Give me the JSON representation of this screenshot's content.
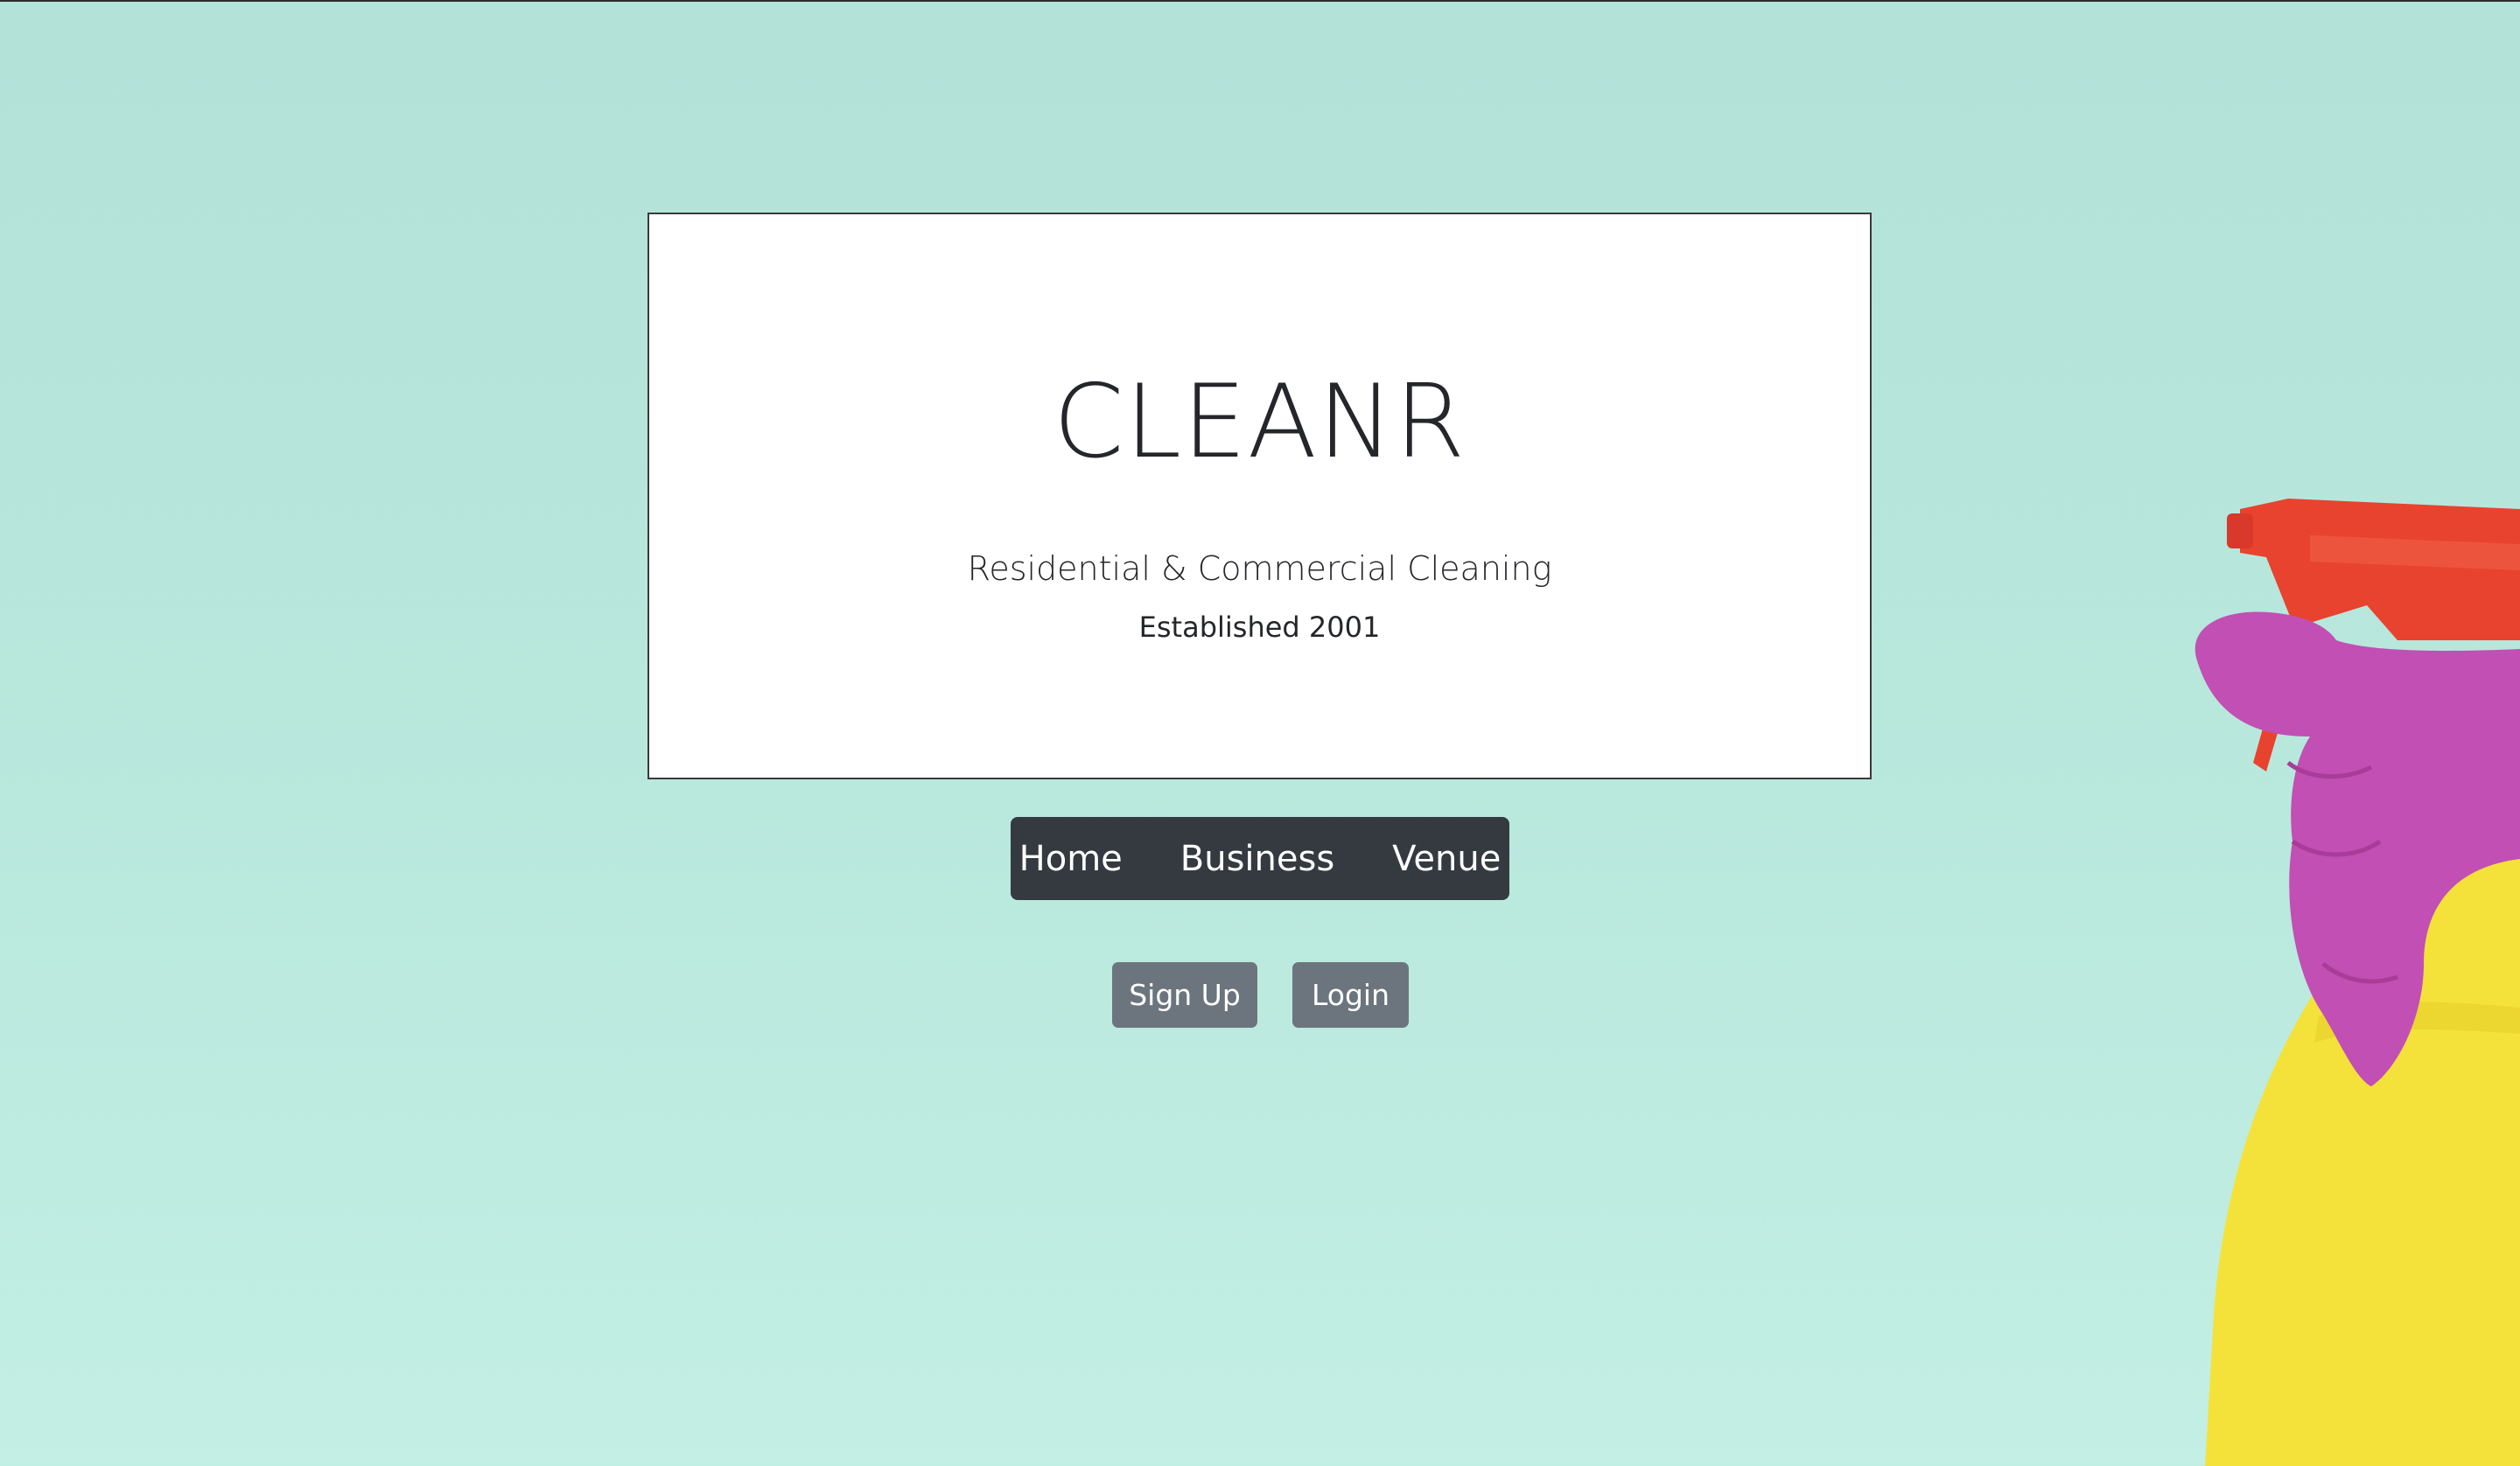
{
  "hero": {
    "title": "CLEANR",
    "tagline": "Residential & Commercial Cleaning",
    "established": "Established 2001"
  },
  "nav": {
    "items": [
      {
        "label": "Home"
      },
      {
        "label": "Business"
      },
      {
        "label": "Venue"
      }
    ],
    "background": "#343a40"
  },
  "auth": {
    "signup_label": "Sign Up",
    "login_label": "Login",
    "button_color": "#6c757d"
  },
  "background_image": {
    "icon": "spray-bottle-hand-icon",
    "colors": {
      "background": "#b5e5da",
      "trigger": "#e8432f",
      "glove": "#c24fb3",
      "bottle": "#f4e23a"
    }
  }
}
